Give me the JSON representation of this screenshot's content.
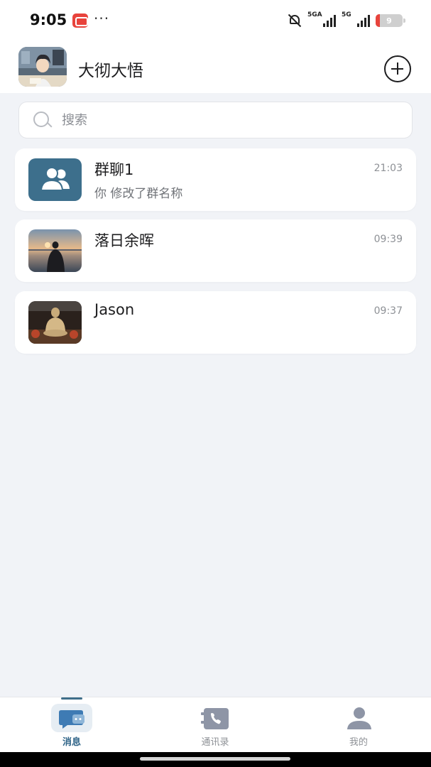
{
  "status_bar": {
    "time": "9:05",
    "overflow_dots": "···",
    "signal_1_label": "5GA",
    "signal_2_label": "5G",
    "battery_level": "9"
  },
  "header": {
    "title": "大彻大悟"
  },
  "search": {
    "placeholder": "搜索"
  },
  "conversations": [
    {
      "name": "群聊1",
      "time": "21:03",
      "preview": "你 修改了群名称",
      "avatar_icon": "group-icon"
    },
    {
      "name": "落日余晖",
      "time": "09:39",
      "preview": "",
      "avatar_icon": "sunset-photo"
    },
    {
      "name": "Jason",
      "time": "09:37",
      "preview": "",
      "avatar_icon": "statue-photo"
    }
  ],
  "bottom_nav": [
    {
      "label": "消息",
      "icon": "chat-icon",
      "active": true
    },
    {
      "label": "通讯录",
      "icon": "contacts-icon",
      "active": false
    },
    {
      "label": "我的",
      "icon": "person-icon",
      "active": false
    }
  ],
  "colors": {
    "page_background": "#f1f3f7",
    "accent": "#2f6488",
    "group_avatar": "#3d6f8c",
    "inactive_icon": "#8e95a6"
  }
}
